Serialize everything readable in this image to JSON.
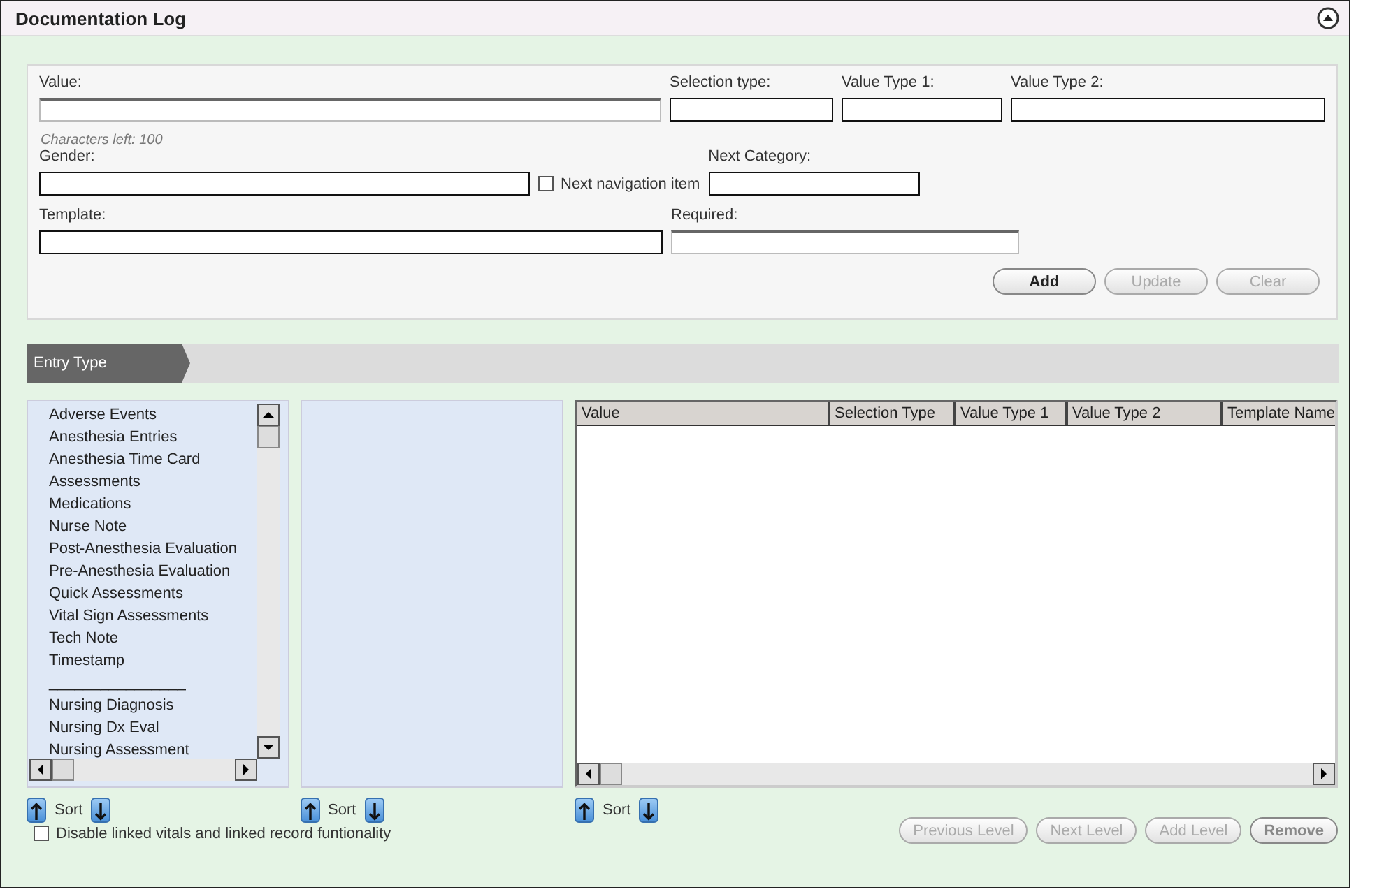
{
  "window": {
    "title": "Documentation Log"
  },
  "form": {
    "value": {
      "label": "Value:"
    },
    "selection_type": {
      "label": "Selection type:"
    },
    "value_type_1": {
      "label": "Value Type 1:"
    },
    "value_type_2": {
      "label": "Value Type 2:"
    },
    "characters_left": "Characters left: 100",
    "gender": {
      "label": "Gender:"
    },
    "next_navigation_item": {
      "label": "Next navigation item",
      "checked": false
    },
    "next_category": {
      "label": "Next Category:"
    },
    "template": {
      "label": "Template:"
    },
    "required": {
      "label": "Required:"
    },
    "buttons": [
      {
        "label": "Add",
        "disabled": false
      },
      {
        "label": "Update",
        "disabled": true
      },
      {
        "label": "Clear",
        "disabled": true
      }
    ]
  },
  "breadcrumb": [
    {
      "label": "Entry Type",
      "selected": true
    }
  ],
  "entry_types": [
    "Adverse Events",
    "Anesthesia Entries",
    "Anesthesia Time Card",
    "Assessments",
    "Medications",
    "Nurse Note",
    "Post-Anesthesia Evaluation",
    "Pre-Anesthesia Evaluation",
    "Quick Assessments",
    "Vital Sign Assessments",
    "Tech Note",
    "Timestamp",
    "________________",
    "Nursing Diagnosis",
    "Nursing Dx Eval",
    "Nursing Assessment"
  ],
  "sort_label": [
    "Sort",
    "Sort",
    "Sort"
  ],
  "table": {
    "columns": [
      "Value",
      "Selection Type",
      "Value Type 1",
      "Value Type 2",
      "Template Name"
    ]
  },
  "disable_linked": {
    "label": "Disable linked vitals and linked record funtionality",
    "checked": false
  },
  "level_buttons": [
    {
      "label": "Previous Level",
      "disabled": true
    },
    {
      "label": "Next Level",
      "disabled": true
    },
    {
      "label": "Add Level",
      "disabled": true
    },
    {
      "label": "Remove",
      "disabled": false
    }
  ]
}
